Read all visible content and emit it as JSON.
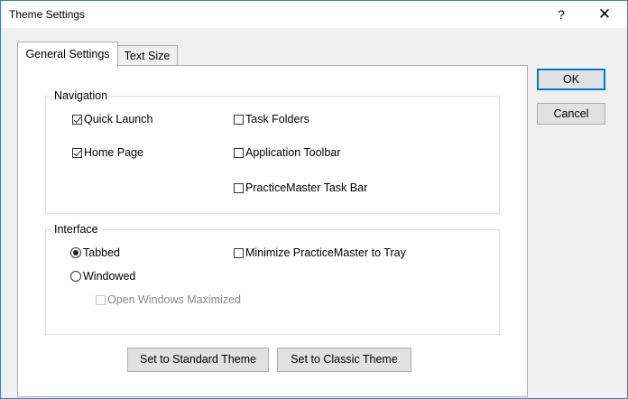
{
  "window": {
    "title": "Theme Settings",
    "help_glyph": "?",
    "close_glyph": "✕"
  },
  "tabs": [
    {
      "label": "General Settings",
      "selected": true
    },
    {
      "label": "Text Size",
      "selected": false
    }
  ],
  "navigation": {
    "label": "Navigation",
    "options": [
      {
        "label": "Quick Launch",
        "checked": true
      },
      {
        "label": "Task Folders",
        "checked": false
      },
      {
        "label": "Home Page",
        "checked": true
      },
      {
        "label": "Application Toolbar",
        "checked": false
      },
      {
        "label": "PracticeMaster Task Bar",
        "checked": false
      }
    ]
  },
  "interface": {
    "label": "Interface",
    "tabbed_label": "Tabbed",
    "tabbed_selected": true,
    "windowed_label": "Windowed",
    "windowed_selected": false,
    "minimize_label": "Minimize PracticeMaster to Tray",
    "minimize_checked": false,
    "maximized_label": "Open Windows Maximized",
    "maximized_checked": false,
    "maximized_enabled": false
  },
  "buttons": {
    "ok": "OK",
    "cancel": "Cancel",
    "standard_theme": "Set to Standard Theme",
    "classic_theme": "Set to Classic Theme"
  },
  "colors": {
    "window_border": "#3c7fb1",
    "dialog_background": "#f0f0f0",
    "default_button_border": "#0078d7"
  }
}
